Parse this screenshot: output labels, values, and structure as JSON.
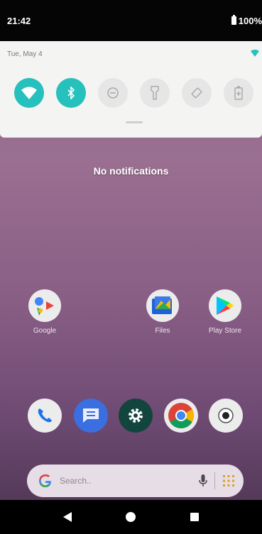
{
  "status_bar": {
    "time": "21:42",
    "battery": "100%"
  },
  "quick_settings": {
    "date": "Tue, May 4",
    "tiles": [
      {
        "icon": "wifi-icon",
        "state": "on"
      },
      {
        "icon": "bluetooth-icon",
        "state": "on"
      },
      {
        "icon": "do-not-disturb-icon",
        "state": "off"
      },
      {
        "icon": "flashlight-icon",
        "state": "off"
      },
      {
        "icon": "auto-rotate-icon",
        "state": "off"
      },
      {
        "icon": "battery-saver-icon",
        "state": "off"
      }
    ],
    "accent_color": "#26c0bd"
  },
  "notifications": {
    "empty_text": "No notifications"
  },
  "home_apps": [
    {
      "label": "Google",
      "icon": "google-folder-icon"
    },
    {
      "label": "Files",
      "icon": "files-icon"
    },
    {
      "label": "Play Store",
      "icon": "play-store-icon"
    }
  ],
  "dock": [
    {
      "icon": "phone-icon"
    },
    {
      "icon": "messages-icon"
    },
    {
      "icon": "settings-icon"
    },
    {
      "icon": "chrome-icon"
    },
    {
      "icon": "camera-icon"
    }
  ],
  "search": {
    "placeholder": "Search..",
    "mic_icon": "mic-icon",
    "apps_icon": "app-grid-icon"
  },
  "nav": {
    "back": "back-icon",
    "home": "home-icon",
    "recents": "recents-icon"
  }
}
